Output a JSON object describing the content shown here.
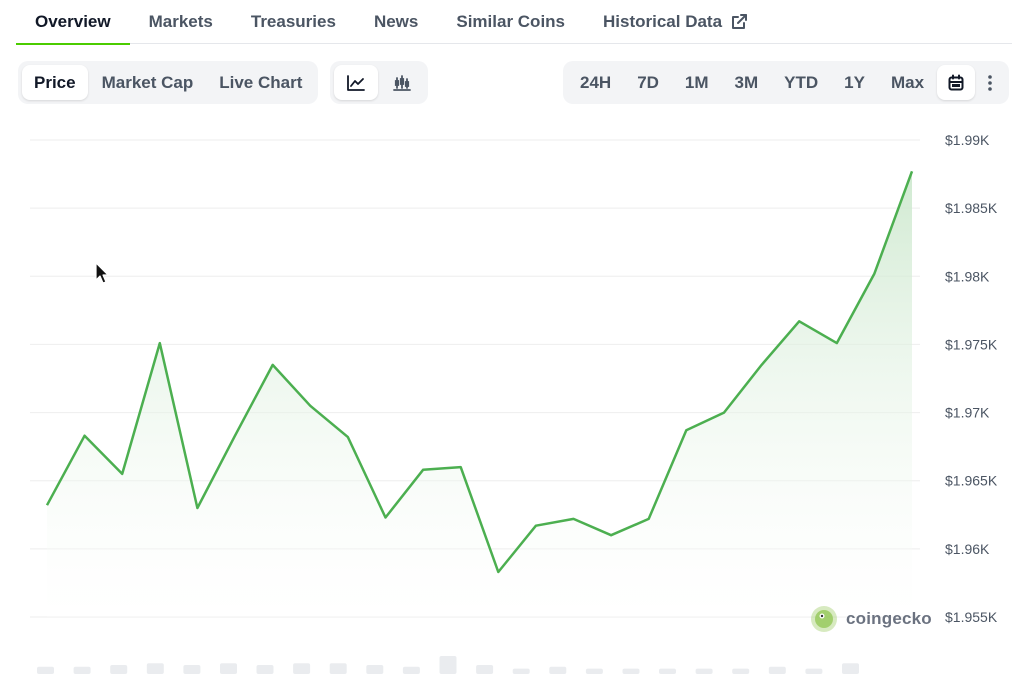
{
  "tabs": [
    {
      "label": "Overview",
      "active": true
    },
    {
      "label": "Markets",
      "active": false
    },
    {
      "label": "Treasuries",
      "active": false
    },
    {
      "label": "News",
      "active": false
    },
    {
      "label": "Similar Coins",
      "active": false
    },
    {
      "label": "Historical Data",
      "active": false,
      "icon": "external-link-icon"
    }
  ],
  "metric_toggle": [
    {
      "label": "Price",
      "active": true
    },
    {
      "label": "Market Cap",
      "active": false
    },
    {
      "label": "Live Chart",
      "active": false
    }
  ],
  "chart_type_toggle": [
    {
      "icon": "line-chart-icon",
      "active": true
    },
    {
      "icon": "candlestick-chart-icon",
      "active": false
    }
  ],
  "range_toggle": [
    {
      "label": "24H",
      "active": false
    },
    {
      "label": "7D",
      "active": false
    },
    {
      "label": "1M",
      "active": false
    },
    {
      "label": "3M",
      "active": false
    },
    {
      "label": "YTD",
      "active": false
    },
    {
      "label": "1Y",
      "active": false
    },
    {
      "label": "Max",
      "active": false
    }
  ],
  "toolbar_icons": [
    "calendar-icon",
    "more-vertical-icon"
  ],
  "watermark": {
    "text": "coingecko",
    "icon": "coingecko-logo-icon"
  },
  "colors": {
    "line": "#4caf50",
    "area_top": "#c8e6c9",
    "active_tab_underline": "#4bcc00",
    "grid": "#eeeeee",
    "axis_text": "#4b5563"
  },
  "chart_data": {
    "type": "area",
    "x": [
      1,
      2,
      3,
      4,
      5,
      6,
      7,
      8,
      9,
      10,
      11,
      12,
      13,
      14,
      15,
      16,
      17,
      18,
      19,
      20,
      21,
      22,
      23,
      24
    ],
    "series": [
      {
        "values": [
          1963.2,
          1968.3,
          1965.5,
          1975.1,
          1963.0,
          1968.3,
          1973.5,
          1970.5,
          1968.2,
          1962.3,
          1965.8,
          1966.0,
          1958.3,
          1961.7,
          1962.2,
          1961.0,
          1962.2,
          1968.7,
          1970.0,
          1973.5,
          1976.7,
          1975.1,
          1980.2,
          1987.7
        ]
      }
    ],
    "y_ticks": [
      "$1.99K",
      "$1.985K",
      "$1.98K",
      "$1.975K",
      "$1.97K",
      "$1.965K",
      "$1.96K",
      "$1.955K"
    ],
    "y_tick_values": [
      1990,
      1985,
      1980,
      1975,
      1970,
      1965,
      1960,
      1955
    ],
    "ylim": [
      1955,
      1990
    ],
    "y_axis_position": "right",
    "grid": true,
    "volume": [
      0.4,
      0.4,
      0.5,
      0.6,
      0.5,
      0.6,
      0.5,
      0.6,
      0.6,
      0.5,
      0.4,
      1.0,
      0.5,
      0.3,
      0.4,
      0.3,
      0.3,
      0.3,
      0.3,
      0.3,
      0.4,
      0.3,
      0.6
    ]
  }
}
